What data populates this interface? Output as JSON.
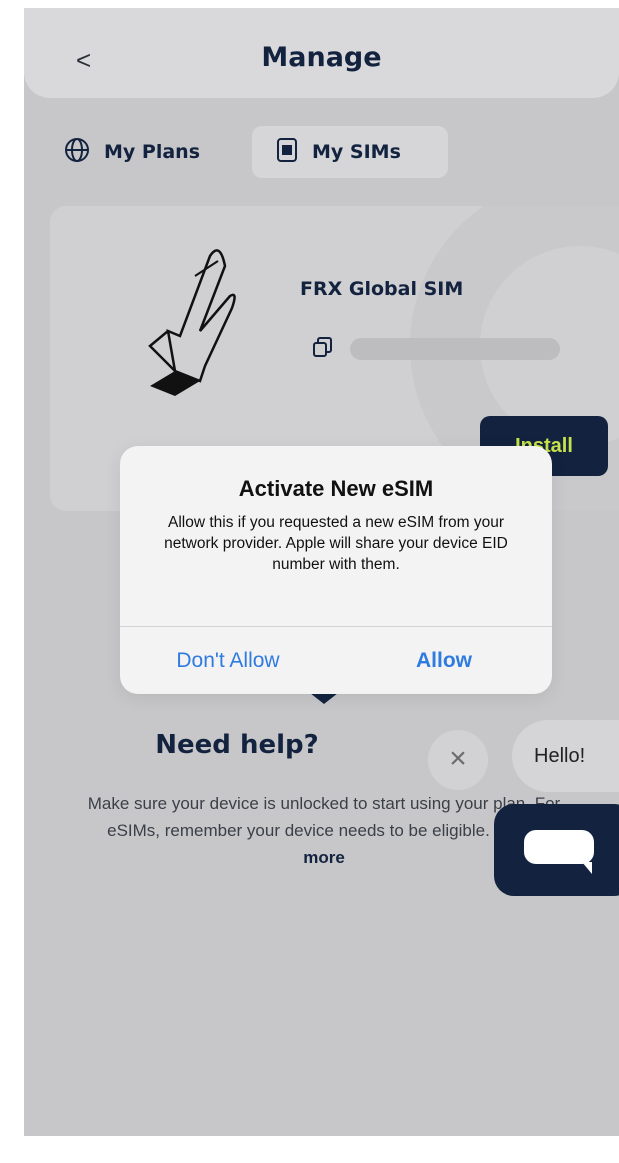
{
  "header": {
    "back_label": "<",
    "title": "Manage"
  },
  "tabs": [
    {
      "label": "My Plans",
      "icon": "globe-icon"
    },
    {
      "label": "My SIMs",
      "icon": "sim-icon",
      "selected": true
    }
  ],
  "sim_card": {
    "name": "FRX Global SIM",
    "install_label": "Install"
  },
  "help": {
    "title": "Need help?",
    "body": "Make sure your device is unlocked to start using your plan. For eSIMs, remember your device needs to be eligible.",
    "link": "Learn more"
  },
  "dialog": {
    "title": "Activate New eSIM",
    "message": "Allow this if you requested a new eSIM from your network provider. Apple will share your device EID number with them.",
    "dont_allow": "Don't Allow",
    "allow": "Allow"
  },
  "chat": {
    "close_label": "×",
    "greeting": "Hello!"
  },
  "colors": {
    "brand_navy": "#13233f",
    "accent_green": "#c7e24a",
    "ios_blue": "#2f7be0"
  }
}
